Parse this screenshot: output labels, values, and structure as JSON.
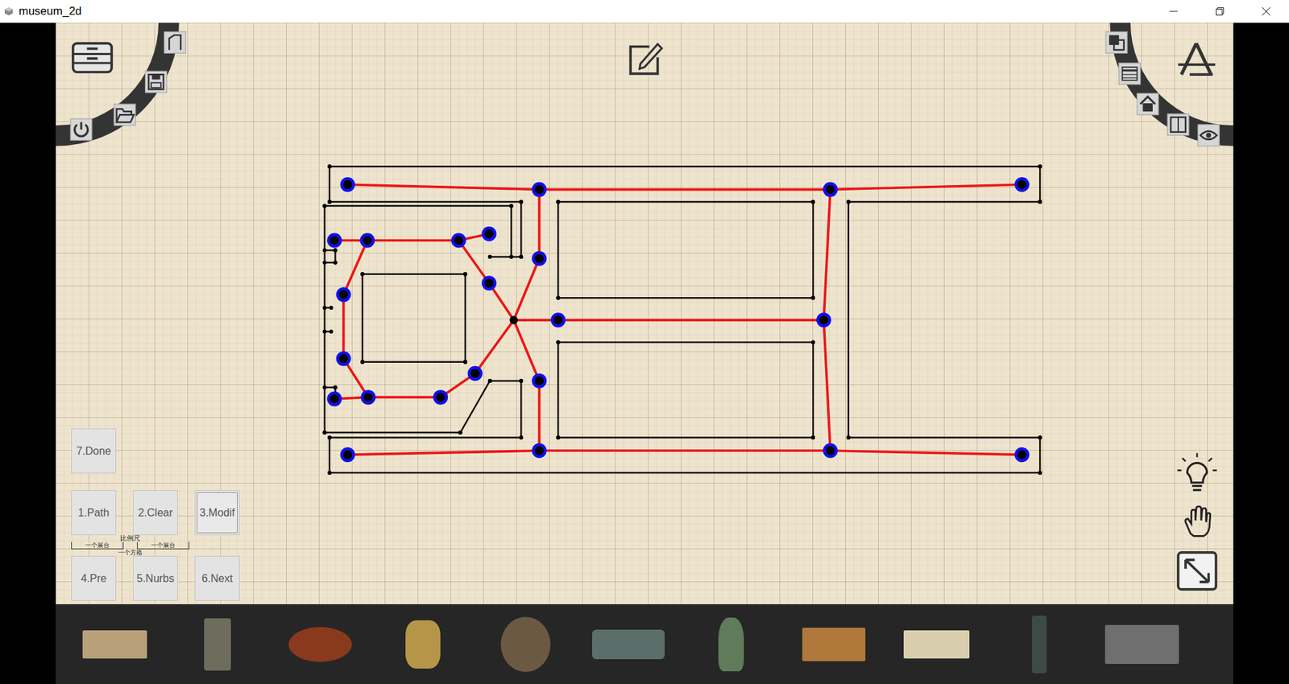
{
  "window": {
    "title": "museum_2d"
  },
  "button_rows": [
    [
      {
        "label": "7.Done",
        "focused": false
      }
    ],
    [
      {
        "label": "1.Path",
        "focused": false
      },
      {
        "label": "2.Clear",
        "focused": false
      },
      {
        "label": "3.Modif",
        "focused": true
      }
    ],
    [
      {
        "label": "4.Pre",
        "focused": false
      },
      {
        "label": "5.Nurbs",
        "focused": false
      },
      {
        "label": "6.Next",
        "focused": false
      }
    ]
  ],
  "scale_legend": {
    "title": "比例尺",
    "booth_labels": [
      "一个展台",
      "一个展台"
    ],
    "grid_label": "一个方格"
  }
}
